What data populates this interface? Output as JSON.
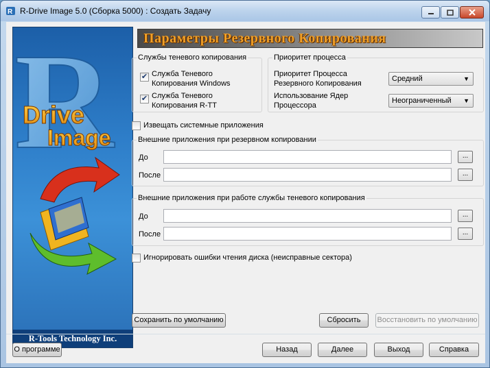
{
  "window": {
    "title": "R-Drive Image 5.0 (Сборка 5000) : Создать Задачу"
  },
  "sidebar": {
    "logo_r": "R",
    "logo_drive": "Drive",
    "logo_image": "Image",
    "footer": "R-Tools Technology Inc."
  },
  "header": {
    "title": "Параметры Резервного Копирования"
  },
  "shadow_services": {
    "title": "Службы теневого копирования",
    "items": [
      {
        "label": "Служба Теневого Копирования Windows",
        "checked": true
      },
      {
        "label": "Служба Теневого Копирования R-TT",
        "checked": true
      }
    ]
  },
  "process_priority": {
    "title": "Приоритет процесса",
    "priority_label": "Приоритет Процесса Резервного Копирования",
    "priority_value": "Средний",
    "cpu_label": "Использование Ядер Процессора",
    "cpu_value": "Неограниченный"
  },
  "notify_apps": {
    "label": "Извещать системные приложения",
    "checked": false
  },
  "external_backup": {
    "title": "Внешние приложения при резервном копировании",
    "before_label": "До",
    "after_label": "После",
    "browse_label": "..."
  },
  "external_shadow": {
    "title": "Внешние приложения при работе службы теневого копирования",
    "before_label": "До",
    "after_label": "После",
    "browse_label": "..."
  },
  "ignore_errors": {
    "label": "Игнорировать ошибки чтения диска (неисправные сектора)",
    "checked": false
  },
  "buttons": {
    "save_default": "Сохранить по умолчанию",
    "reset": "Сбросить",
    "restore_default": "Восстановить по умолчанию",
    "about": "О программе",
    "back": "Назад",
    "next": "Далее",
    "exit": "Выход",
    "help": "Справка"
  }
}
